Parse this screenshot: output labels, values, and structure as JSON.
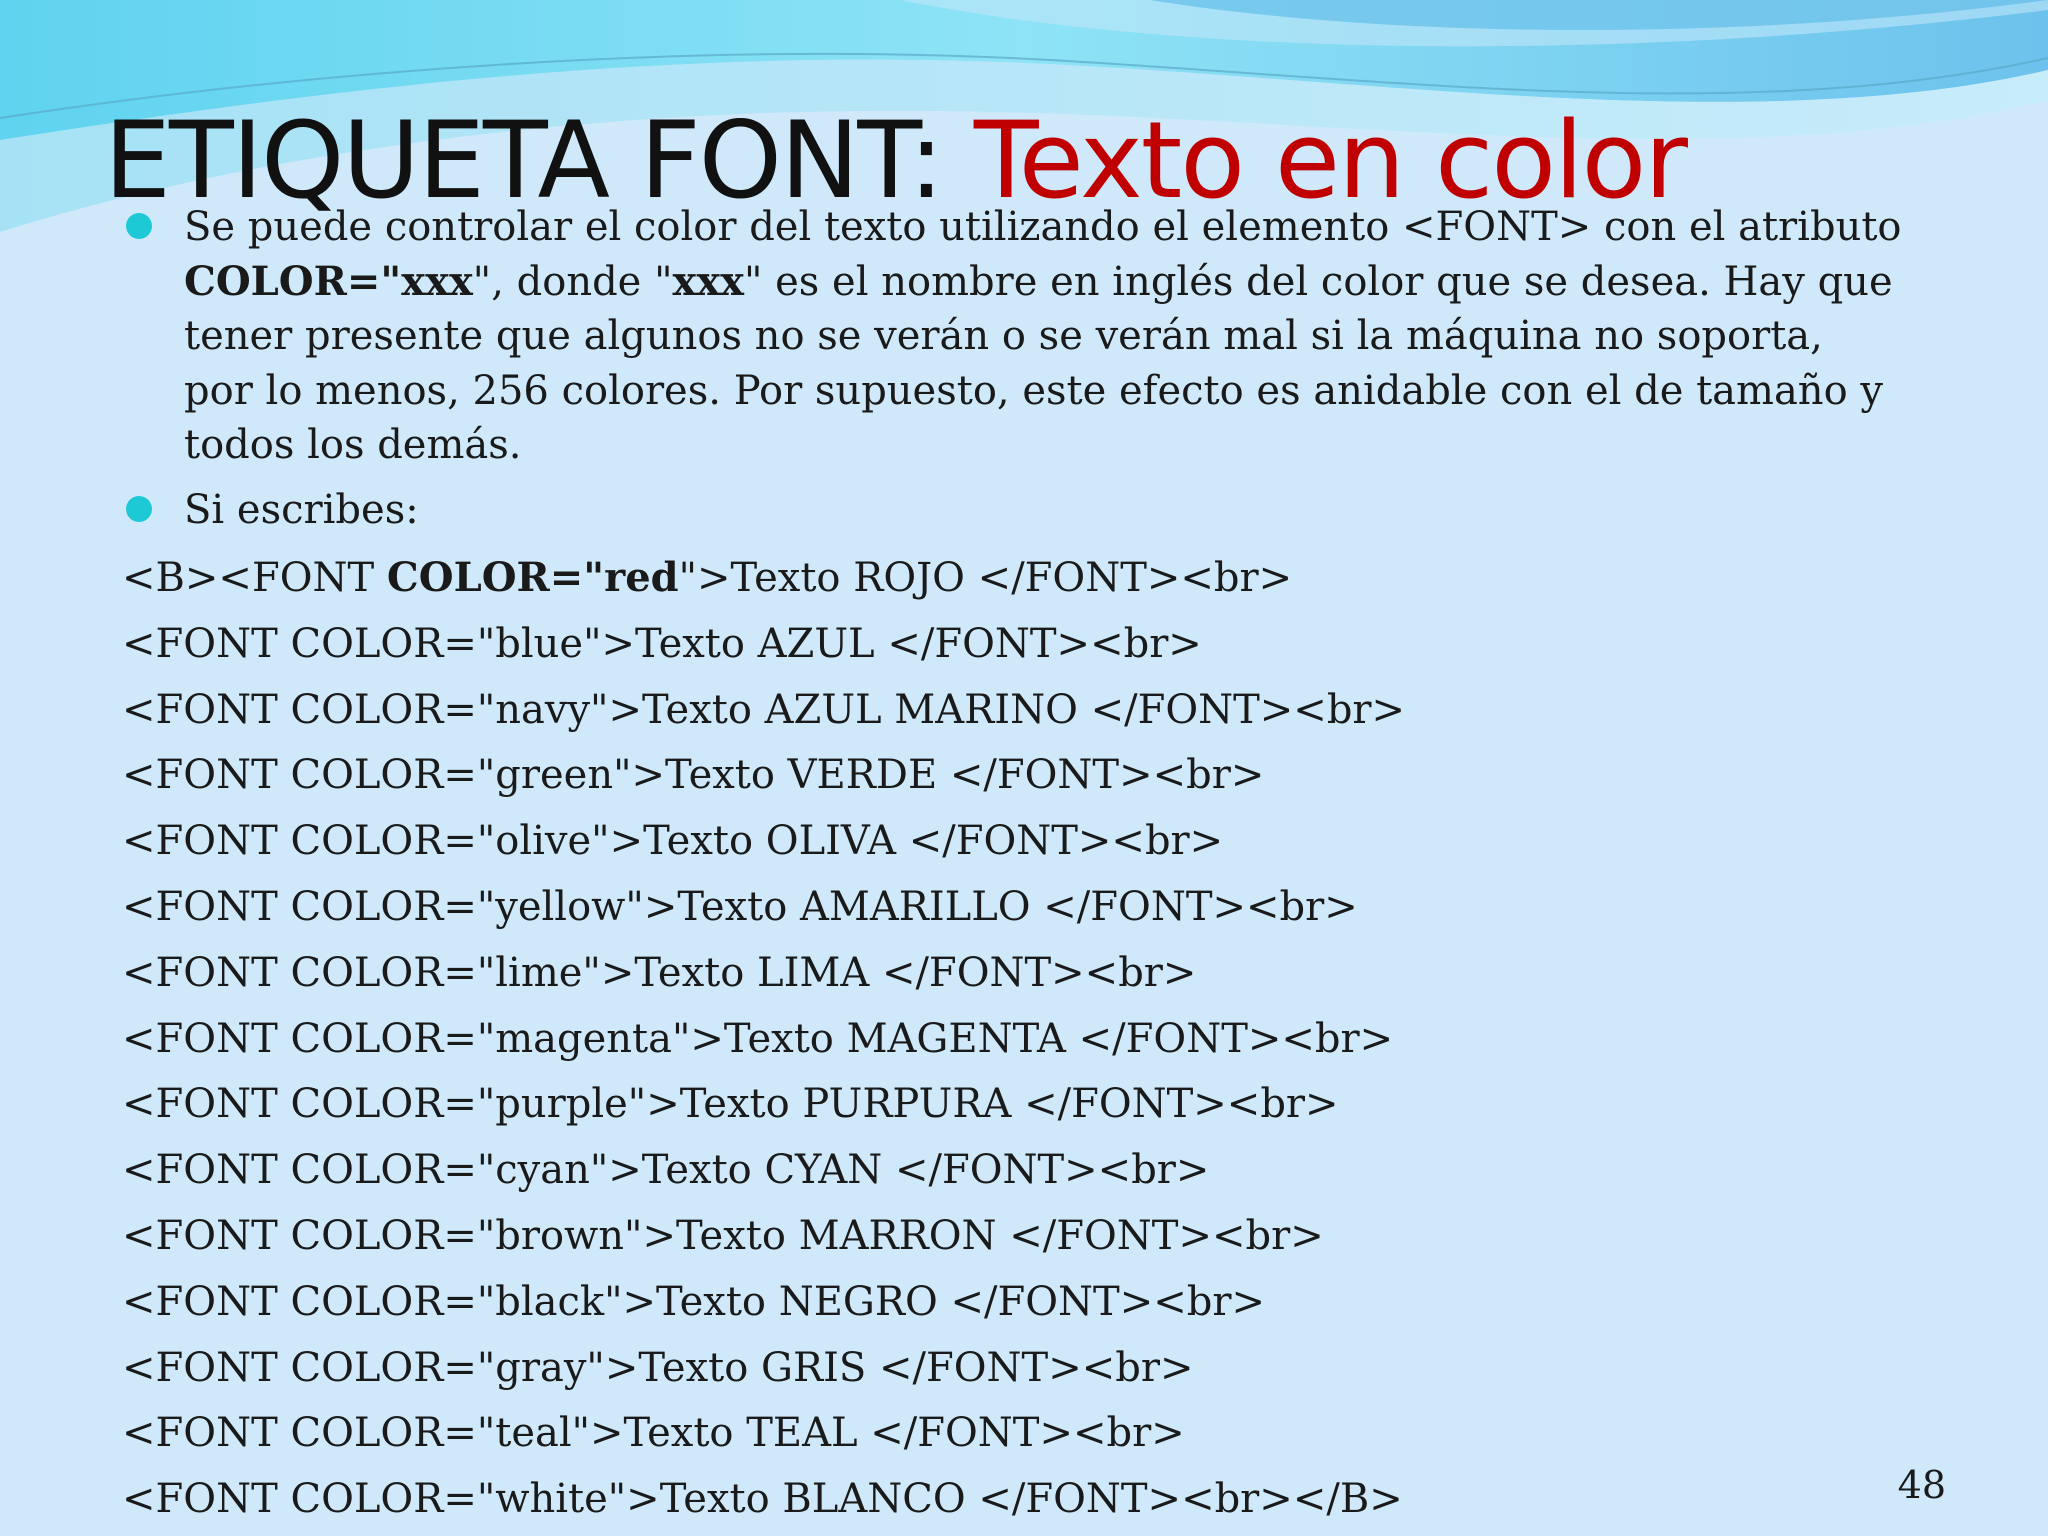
{
  "title": {
    "prefix": "ETIQUETA FONT: ",
    "accent": "Texto en color"
  },
  "colors": {
    "background": "#cfe9fb",
    "title_accent": "#c00000",
    "bullet": "#1ec9d6"
  },
  "bullets": [
    {
      "text_1": "Se puede controlar el color del texto utilizando el elemento <FONT> con el atributo ",
      "bold_1": "COLOR=\"xxx",
      "text_2": "\", donde \"",
      "bold_2": "xxx",
      "text_3": "\" es el nombre en inglés del color que se desea. Hay que tener presente que algunos no se verán o se verán mal si la máquina no soporta, por lo menos, 256 colores. Por supuesto, este efecto es anidable con el de tamaño y todos los demás."
    },
    {
      "text": "Si escribes:"
    }
  ],
  "code_first": {
    "pre": "<B><FONT ",
    "bold": "COLOR=\"red",
    "post": "\">Texto ROJO </FONT><br>"
  },
  "code_lines": [
    "<FONT COLOR=\"blue\">Texto AZUL </FONT><br>",
    "<FONT COLOR=\"navy\">Texto AZUL MARINO </FONT><br>",
    "<FONT COLOR=\"green\">Texto VERDE </FONT><br>",
    "<FONT COLOR=\"olive\">Texto OLIVA </FONT><br>",
    "<FONT COLOR=\"yellow\">Texto AMARILLO </FONT><br>",
    "<FONT COLOR=\"lime\">Texto LIMA </FONT><br>",
    "<FONT COLOR=\"magenta\">Texto MAGENTA </FONT><br>",
    "<FONT COLOR=\"purple\">Texto PURPURA </FONT><br>",
    "<FONT COLOR=\"cyan\">Texto CYAN </FONT><br>",
    "<FONT COLOR=\"brown\">Texto MARRON </FONT><br>",
    "<FONT COLOR=\"black\">Texto NEGRO </FONT><br>",
    "<FONT COLOR=\"gray\">Texto GRIS </FONT><br>",
    "<FONT COLOR=\"teal\">Texto TEAL </FONT><br>",
    "<FONT COLOR=\"white\">Texto BLANCO </FONT><br></B>"
  ],
  "page_number": "48"
}
